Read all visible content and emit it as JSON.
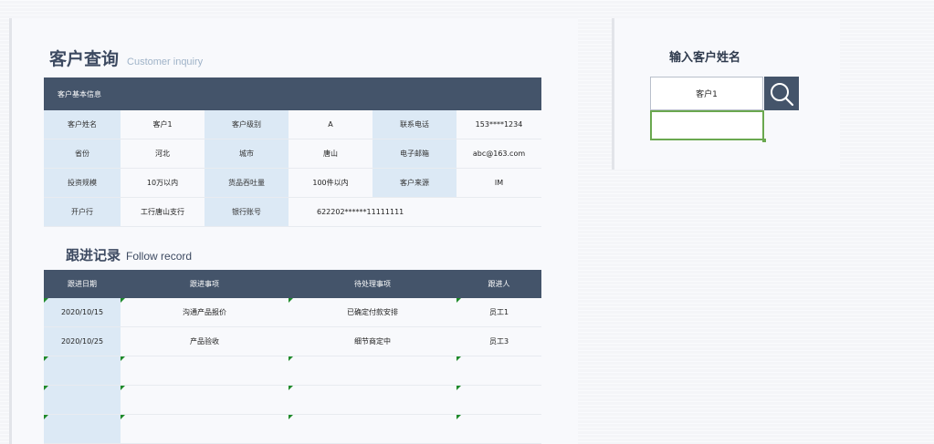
{
  "customer_page": {
    "title": "客户查询",
    "subtitle": "Customer inquiry",
    "basic_info_header": "客户基本信息",
    "info_rows": [
      [
        {
          "label": "客户姓名",
          "value": "客户1"
        },
        {
          "label": "客户级别",
          "value": "A"
        },
        {
          "label": "联系电话",
          "value": "153****1234"
        }
      ],
      [
        {
          "label": "省份",
          "value": "河北"
        },
        {
          "label": "城市",
          "value": "唐山"
        },
        {
          "label": "电子邮箱",
          "value": "abc@163.com"
        }
      ],
      [
        {
          "label": "投资规模",
          "value": "10万以内"
        },
        {
          "label": "货品吞吐量",
          "value": "100件以内"
        },
        {
          "label": "客户来源",
          "value": "IM"
        }
      ],
      [
        {
          "label": "开户行",
          "value": "工行唐山支行"
        },
        {
          "label": "银行账号",
          "value": "622202******11111111"
        }
      ]
    ]
  },
  "follow": {
    "title": "跟进记录",
    "subtitle": "Follow record",
    "columns": [
      "跟进日期",
      "跟进事项",
      "待处理事项",
      "跟进人"
    ],
    "rows": [
      [
        "2020/10/15",
        "沟通产品报价",
        "已确定付款安排",
        "员工1"
      ],
      [
        "2020/10/25",
        "产品验收",
        "细节商定中",
        "员工3"
      ]
    ]
  },
  "search": {
    "label": "输入客户姓名",
    "value": "客户1",
    "icon": "search-icon"
  }
}
